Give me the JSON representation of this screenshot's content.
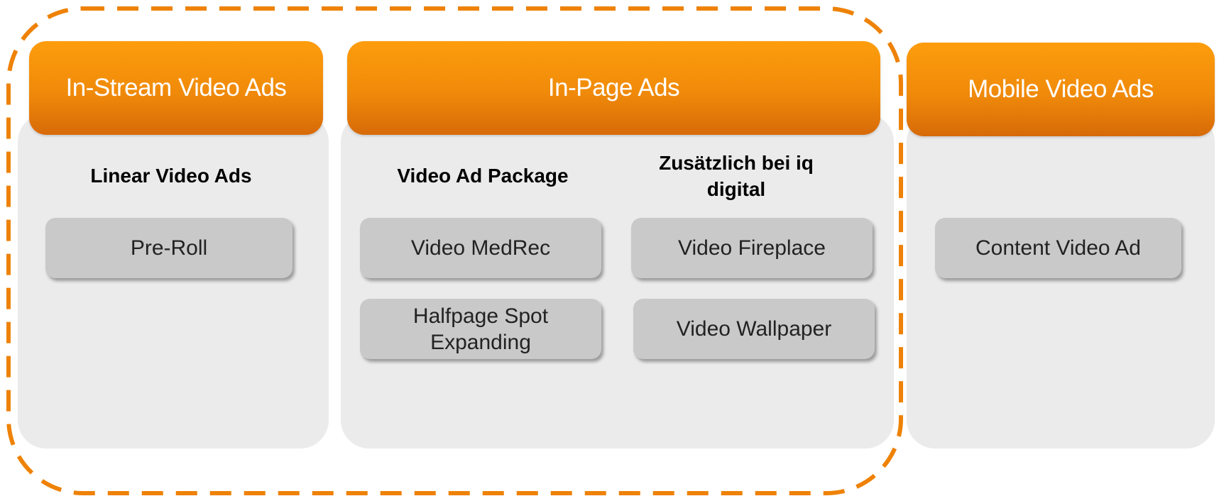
{
  "colors": {
    "accent_orange": "#f08a0a",
    "dashed_outline": "#ee8207",
    "panel_bg": "#ebebeb",
    "chip_bg": "#c9c9c9"
  },
  "in_stream": {
    "header": "In-Stream Video Ads",
    "title": "Linear Video Ads",
    "items": [
      "Pre-Roll"
    ]
  },
  "in_page": {
    "header": "In-Page Ads",
    "left_title": "Video Ad Package",
    "left_items": [
      "Video MedRec",
      "Halfpage Spot Expanding"
    ],
    "right_title": "Zusätzlich bei iq digital",
    "right_items": [
      "Video Fireplace",
      "Video Wallpaper"
    ]
  },
  "mobile": {
    "header": "Mobile Video Ads",
    "items": [
      "Content Video Ad"
    ]
  }
}
